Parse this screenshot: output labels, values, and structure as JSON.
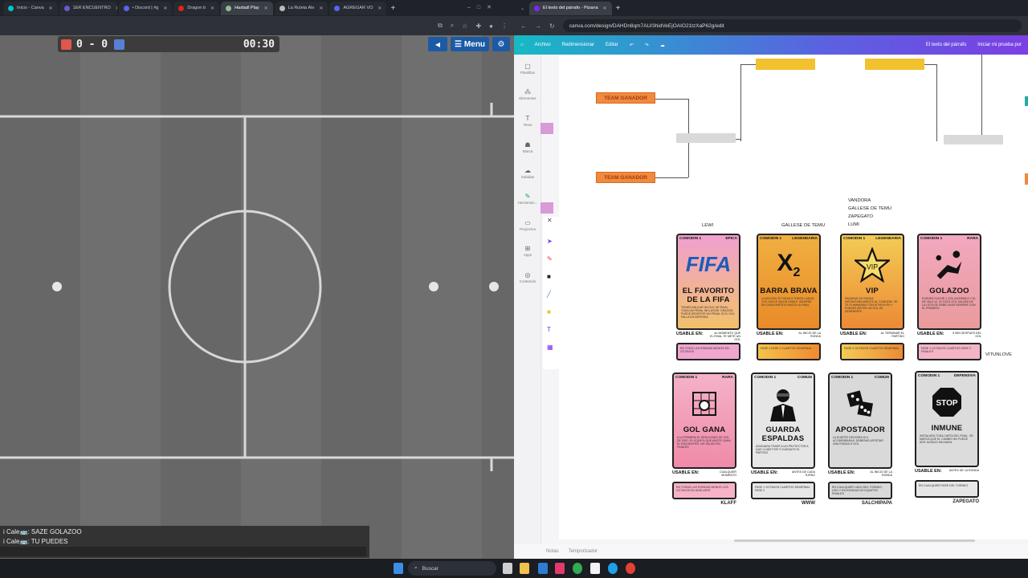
{
  "left_window": {
    "tabs": [
      "Inicio - Canva",
      "1ER ENCUENTRO",
      "• Discord | #g",
      "Dragon b",
      "Haxball Play",
      "La Ruleta Ale",
      "AGREGAR VO"
    ],
    "active_tab": 4
  },
  "haxball": {
    "score": "0 - 0",
    "time": "00:30",
    "red_color": "#e0574a",
    "blue_color": "#5a7fd6",
    "menu_label": "Menu",
    "chat": [
      "i Cale🚌: SAZE GOLAZOO",
      "i Cale🚌: TU PUEDES"
    ]
  },
  "right_window": {
    "tabs": [
      "El texto del párrafo - Pizarra"
    ],
    "url": "canva.com/design/DAHDn8qm7AU/3hidVeEjOAIO21tzXaP62g/edit"
  },
  "canva": {
    "menu": [
      "Archivo",
      "Redimensionar",
      "Editar"
    ],
    "doc_title": "El texto del párrafo",
    "trial": "Iniciar mi prueba por",
    "side": [
      "Plantillas",
      "Elementos",
      "Texto",
      "Marca",
      "Subidas",
      "Herramien...",
      "Proyectos",
      "Apps",
      "Contenido"
    ],
    "bottom": [
      "Notas",
      "Temporizador"
    ],
    "bracket": {
      "team1": "TEAM GANADOR",
      "team2": "TEAM GANADOR"
    },
    "names": {
      "lewi": "LEWI",
      "gallese": "GALLESE DE TEMU",
      "group": [
        "VANDORA",
        "GALLESE DE TEMU",
        "ZAPEGATO",
        "LUMI"
      ],
      "vitun": "VITUNLOVE"
    },
    "cards": [
      {
        "cat": "COMODIN 1",
        "rar": "EPICA",
        "title": "EL FAVORITO DE LA FIFA",
        "desc": "TIENES ANULAR UN GOL DE RIVAL, TODA UN PENAL INCLUSIVE, DRAGON PUEDE REVERTIR UN PENAL SI EL GOL FALLA EN DEFENSA",
        "when": "AL MOMENTO QUE EL RIVAL TE METE UN GOL",
        "box": "EN TODO LAS RONDAS MENOS EN OCTAVOS",
        "owner": ""
      },
      {
        "cat": "COMODIN 1",
        "rar": "LEGENDARIA",
        "title": "BARRA BRAVA",
        "desc": "LA AFICION TE SIGUE A TODOS LADOS, TUS GOLES VALEN DOBLE. SIEMPRE EN CADA PARTIDO HASTA LA FINAL",
        "when": "AL INICIO DE LA RONDA",
        "box": "FASE 1 FASE 2 CUARTOS SEMIFINAL",
        "owner": ""
      },
      {
        "cat": "COMODIN 1",
        "rar": "LEGENDARIA",
        "title": "VIP",
        "desc": "PASARAS DE RONDA INSTANTANEAMENTE AL COMODIN. SE TE ELIMINARAN TODOS REVIVEN Y PUEDES METER UN GOL DE DESEMPATE",
        "when": "AL TERMINAR EL PARTIDO",
        "box": "FASE 2 OCTAVOS CUARTOS SEMIFINAL",
        "owner": ""
      },
      {
        "cat": "COMODIN 1",
        "rar": "RARA",
        "title": "GOLAZOO",
        "desc": "PUEDES ELEGIR 1 GOL INCREIBLE Y EL DE VALE x2. SI TODO GOL VALDRA DE LA LISTA SE DEBE USAR SIEMPRE CON EL PRIMERO",
        "when": "5 MIN DESPUES DEL GOL",
        "box": "FASE 1 OCTAVOS CUARTOS FASE 2 FINALES",
        "owner": ""
      },
      {
        "cat": "COMODIN 1",
        "rar": "RARA",
        "title": "GOL GANA",
        "desc": "A LA PRIMERA EL RESULTADO DE GOL DE ORO. EL EQUIPO QUE ANOTE GANA EL ENCUENTRO. NO VALIDO EN FINALES",
        "when": "CUALQUIER MOMENTO",
        "box": "EN TODAS LAS RONDAS MENOS LOS OCTAVOS EN ADELANTE",
        "owner": "KLAFF"
      },
      {
        "cat": "COMODIN 1",
        "rar": "COMUN",
        "title": "GUARDA ESPALDAS",
        "desc": "ASIGNARA TRAER A UN PROTECTOR A QUE CUIDE POR TI DURANTE EL PARTIDO",
        "when": "ANTES DE CADA TURNO",
        "box": "FASE 1 OCTAVOS CUARTOS SEMIFINAL FASE 2",
        "owner": "WWW"
      },
      {
        "cat": "COMODIN 1",
        "rar": "COMUN",
        "title": "APOSTADOR",
        "desc": "LA SUERTE DECIDIRA SI A ACOMPAÑARAS. DEBERAS APOSTAR UNA RONDA O GOL",
        "when": "AL INICIO DE LA RONDA",
        "box": "EN CUALQUIER LADO DEL TORNEO, USO Y EN RONDAS DE EQUIPOS RIVALES",
        "owner": "SALCHIPAPA"
      },
      {
        "cat": "COMODIN 1",
        "rar": "DEFENSIVA",
        "title": "INMUNE",
        "desc": "INSTALARA TODA CARTA DEL RIVAL. SE MARCA QUE EL CAMBIO NO PUEDE SER JUGADO SIN NADA",
        "when": "ANTES DE LA RONDA",
        "box": "EN CUALQUIER FASE DEL TORNEO",
        "owner": "ZAPEGATO"
      }
    ],
    "usable_label": "USABLE EN:"
  },
  "taskbar": {
    "search": "Buscar"
  }
}
